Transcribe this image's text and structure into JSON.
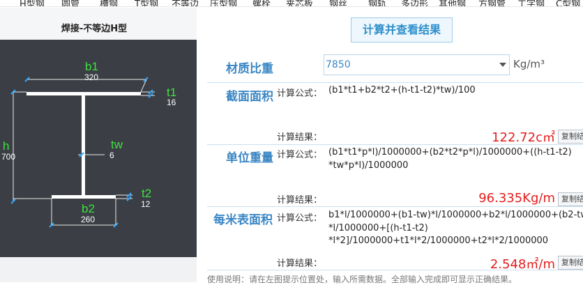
{
  "nav": {
    "items": [
      "H型钢",
      "圆管",
      "槽钢",
      "T型钢",
      "不等边",
      "压型钢",
      "螺栓",
      "夹芯板",
      "钢丝",
      "钢轨",
      "多边形",
      "其他钢",
      "方钢管",
      "工字钢",
      "C型钢"
    ]
  },
  "left": {
    "title": "焊接-不等边H型",
    "labels": {
      "b1": "b1",
      "t1": "t1",
      "h": "h",
      "tw": "tw",
      "t2": "t2",
      "b2": "b2"
    },
    "values": {
      "b1": "320",
      "t1": "16",
      "h": "700",
      "tw": "6",
      "t2": "12",
      "b2": "260"
    }
  },
  "calc_button": "计算并查看结果",
  "density": {
    "label": "材质比重",
    "value": "7850",
    "unit": "Kg/m³"
  },
  "sections": [
    {
      "label": "截面面积",
      "formula_label": "计算公式：",
      "formula_lines": [
        "(b1*t1+b2*t2+(h-t1-t2)*tw)/100"
      ],
      "result_label": "计算结果：",
      "result": "122.72c㎡",
      "copy": "复制结果"
    },
    {
      "label": "单位重量",
      "formula_label": "计算公式：",
      "formula_lines": [
        "(b1*t1*p*l)/1000000+(b2*t2*p*l)/1000000+((h-t1-t2)",
        "*tw*p*l)/1000000"
      ],
      "result_label": "计算结果：",
      "result": "96.335Kg/m",
      "copy": "复制结果"
    },
    {
      "label": "每米表面积",
      "formula_label": "计算公式：",
      "formula_lines": [
        "b1*l/1000000+(b1-tw)*l/1000000+b2*l/1000000+(b2-tw)",
        "*l/1000000+[(h-t1-t2)",
        "*l*2]/1000000+t1*l*2/1000000+t2*l*2/1000000"
      ],
      "result_label": "计算结果：",
      "result": "2.548㎡/m",
      "copy": "复制结果"
    }
  ],
  "hint": "使用说明：请在左图提示位置处，输入所需数据。全部输入完成即可显示正确结果。",
  "colors": {
    "accent": "#3a86c4",
    "result": "#e51c1c",
    "canvas": "#3b3f45",
    "dim_label": "#3fe03f"
  }
}
